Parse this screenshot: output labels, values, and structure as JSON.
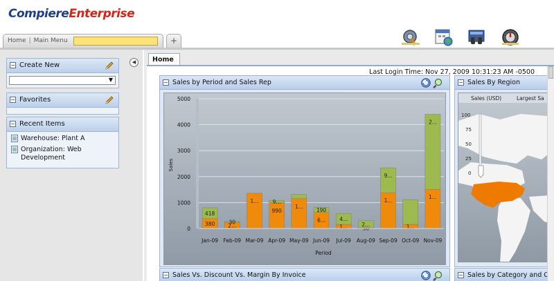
{
  "header": {
    "logo_part1": "Compiere",
    "logo_part2": "Enterprise",
    "breadcrumb_home": "Home",
    "breadcrumb_sep": "|",
    "breadcrumb_menu": "Main Menu",
    "plus_label": "+",
    "icons": [
      "settings-wrench-icon",
      "calendar-globe-icon",
      "binoculars-icon",
      "logout-icon"
    ]
  },
  "left": {
    "create_new": {
      "title": "Create New",
      "selected": ""
    },
    "favorites": {
      "title": "Favorites"
    },
    "recent": {
      "title": "Recent Items",
      "items": [
        {
          "label": "Warehouse: Plant A"
        },
        {
          "label": "Organization: Web Development"
        }
      ]
    }
  },
  "main": {
    "tab": "Home",
    "last_login": "Last Login Time: Nov 27, 2009 10:31:23 AM -0500",
    "portlets": {
      "sales_period": "Sales by Period and Sales Rep",
      "sales_region": "Sales By Region",
      "sales_discount": "Sales Vs. Discount Vs. Margin By Invoice",
      "sales_category": "Sales by Category and Co"
    },
    "region": {
      "col1": "Sales (USD)",
      "col2": "Largest Sa",
      "scale": [
        "100",
        "75",
        "50",
        "25",
        "0"
      ]
    }
  },
  "colors": {
    "orange": "#ef8a0b",
    "green": "#9cba4e",
    "accent_blue": "#1f3f86",
    "accent_red": "#d62418"
  },
  "chart_data": {
    "type": "bar",
    "stacked": true,
    "title": "",
    "xlabel": "Period",
    "ylabel": "Sales",
    "ylim": [
      0,
      5000
    ],
    "yticks": [
      0,
      1000,
      2000,
      3000,
      4000,
      5000
    ],
    "categories": [
      "Jan-09",
      "Feb-09",
      "Mar-09",
      "Apr-09",
      "May-09",
      "Jun-09",
      "Jul-09",
      "Aug-09",
      "Sep-09",
      "Oct-09",
      "Nov-09"
    ],
    "series": [
      {
        "color": "#ef8a0b",
        "values": [
          380,
          240,
          1360,
          990,
          1150,
          620,
          160,
          30,
          1380,
          160,
          1510
        ],
        "labels": [
          "380",
          "2...",
          "1...",
          "990",
          "1...",
          "6...",
          "1...",
          "30",
          "1...",
          "1...",
          "1..."
        ]
      },
      {
        "color": "#9cba4e",
        "values": [
          418,
          30,
          0,
          90,
          160,
          190,
          420,
          270,
          960,
          950,
          2890
        ],
        "labels": [
          "418",
          "30",
          "",
          "9...",
          "",
          "190",
          "4...",
          "2...",
          "9...",
          "",
          "2..."
        ]
      }
    ]
  }
}
